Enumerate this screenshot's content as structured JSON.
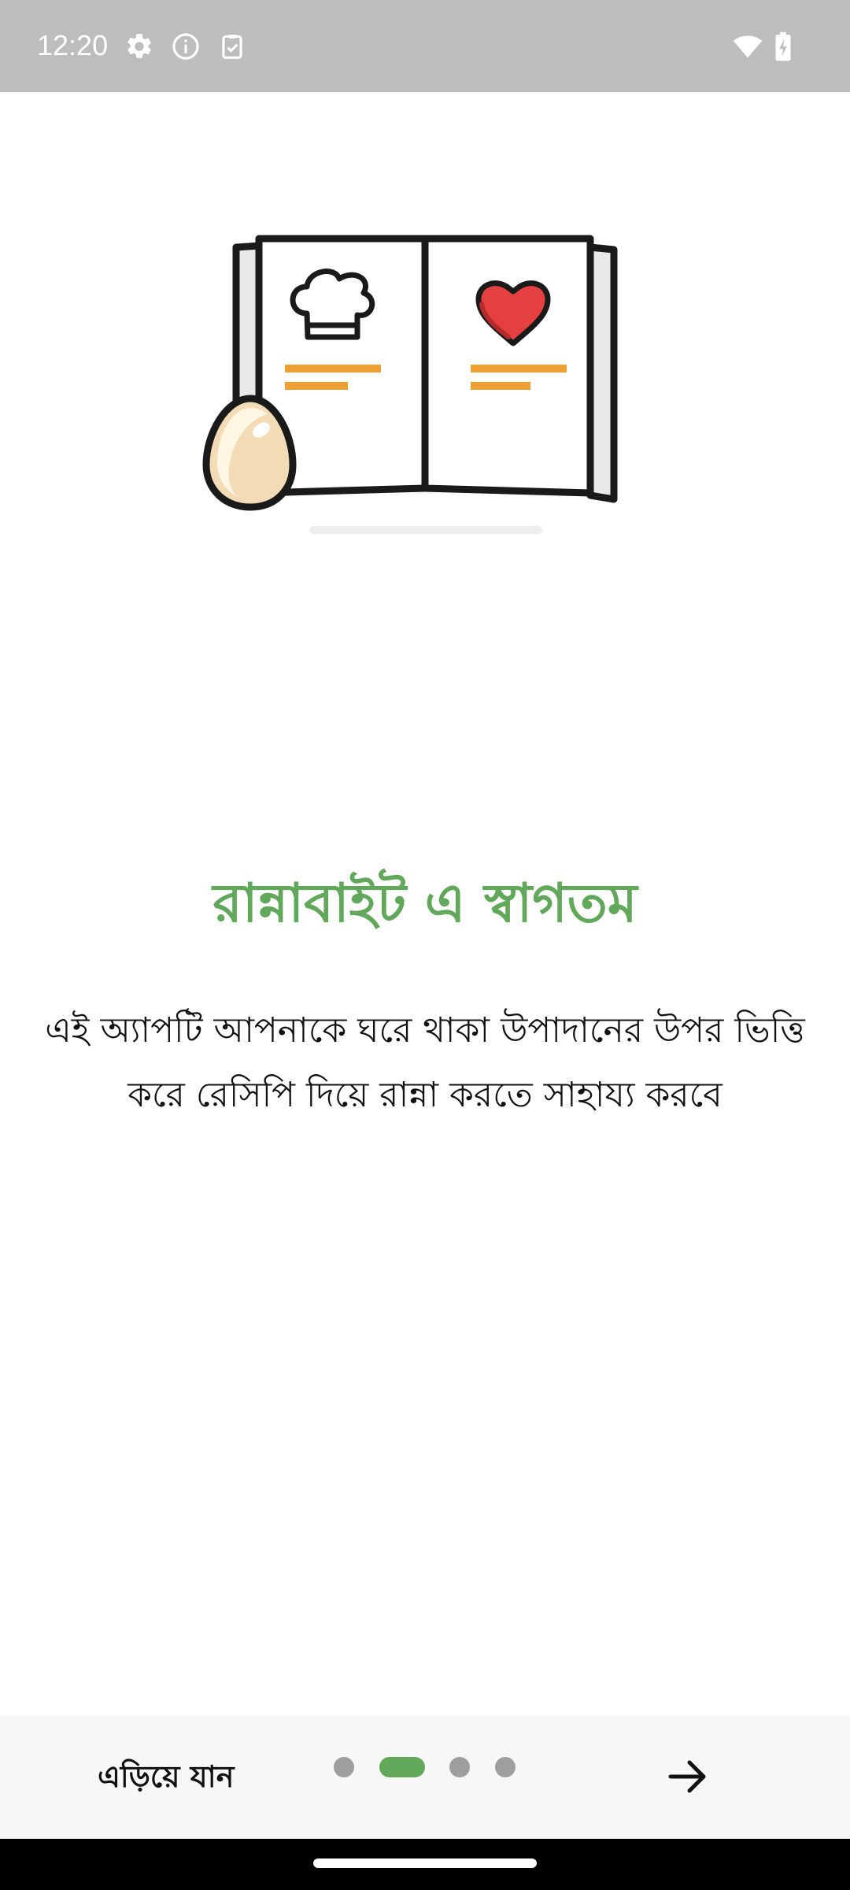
{
  "status_bar": {
    "time": "12:20",
    "left_icons": [
      "gear-icon",
      "info-icon",
      "clipboard-check-icon"
    ],
    "right_icons": [
      "wifi-icon",
      "battery-charging-icon"
    ],
    "background": "#bdbdbd"
  },
  "onboarding": {
    "illustration": "open-recipe-book-icon",
    "title": "রান্নাবাইট এ স্বাগতম",
    "description": "এই অ্যাপটি আপনাকে ঘরে থাকা উপাদানের উপর ভিত্তি করে রেসিপি দিয়ে রান্না করতে সাহায্য করবে",
    "title_color": "#62a85a"
  },
  "bottom_bar": {
    "skip_label": "এড়িয়ে যান",
    "page_indicator": {
      "total": 4,
      "active_index": 1
    },
    "next_icon": "arrow-right-icon",
    "accent": "#62a85a",
    "inactive_dot_color": "#9e9e9e"
  }
}
